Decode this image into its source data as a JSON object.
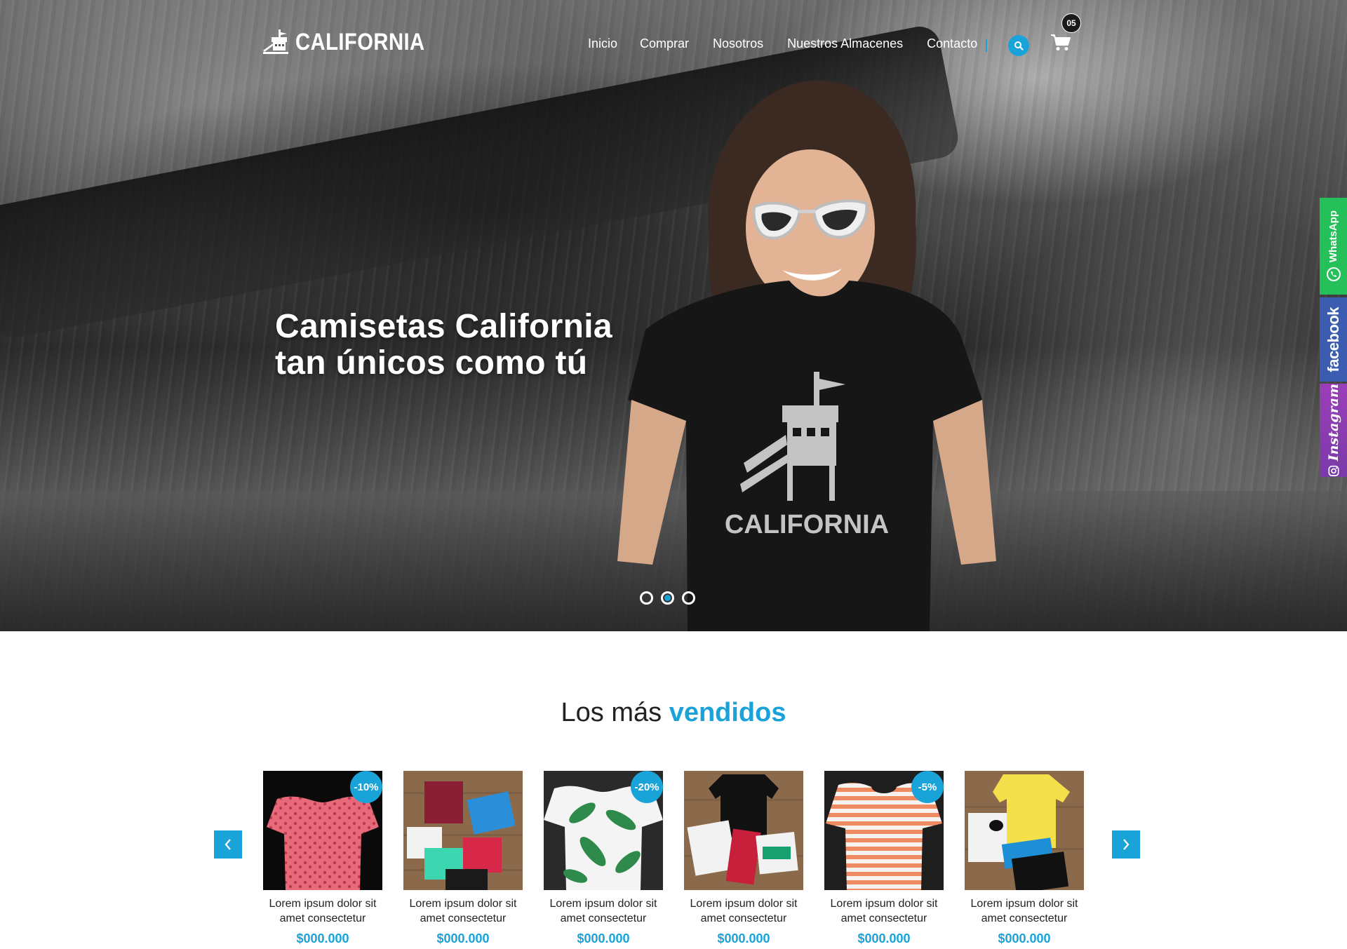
{
  "brand": {
    "name": "CALIFORNIA"
  },
  "nav": {
    "links": [
      "Inicio",
      "Comprar",
      "Nosotros",
      "Nuestros Almacenes",
      "Contacto"
    ],
    "cart_count": "05"
  },
  "hero": {
    "title_line1": "Camisetas California",
    "title_line2": "tan únicos como tú",
    "shirt_print": "CALIFORNIA",
    "slides": 3,
    "active_slide": 2
  },
  "social": {
    "whatsapp": "WhatsApp",
    "facebook": "facebook",
    "instagram": "Instagram"
  },
  "best_sellers": {
    "title_plain": "Los más",
    "title_accent": "vendidos",
    "products": [
      {
        "name": "Lorem ipsum dolor sit amet consectetur",
        "price": "$000.000",
        "discount": "-10%"
      },
      {
        "name": "Lorem ipsum dolor sit amet consectetur",
        "price": "$000.000",
        "discount": ""
      },
      {
        "name": "Lorem ipsum dolor sit amet consectetur",
        "price": "$000.000",
        "discount": "-20%"
      },
      {
        "name": "Lorem ipsum dolor sit amet consectetur",
        "price": "$000.000",
        "discount": ""
      },
      {
        "name": "Lorem ipsum dolor sit amet consectetur",
        "price": "$000.000",
        "discount": "-5%"
      },
      {
        "name": "Lorem ipsum dolor sit amet consectetur",
        "price": "$000.000",
        "discount": ""
      }
    ]
  },
  "colors": {
    "accent": "#1aa3d9",
    "whatsapp": "#25c05a",
    "facebook": "#3b5cb0",
    "instagram": "#8a3db0"
  }
}
